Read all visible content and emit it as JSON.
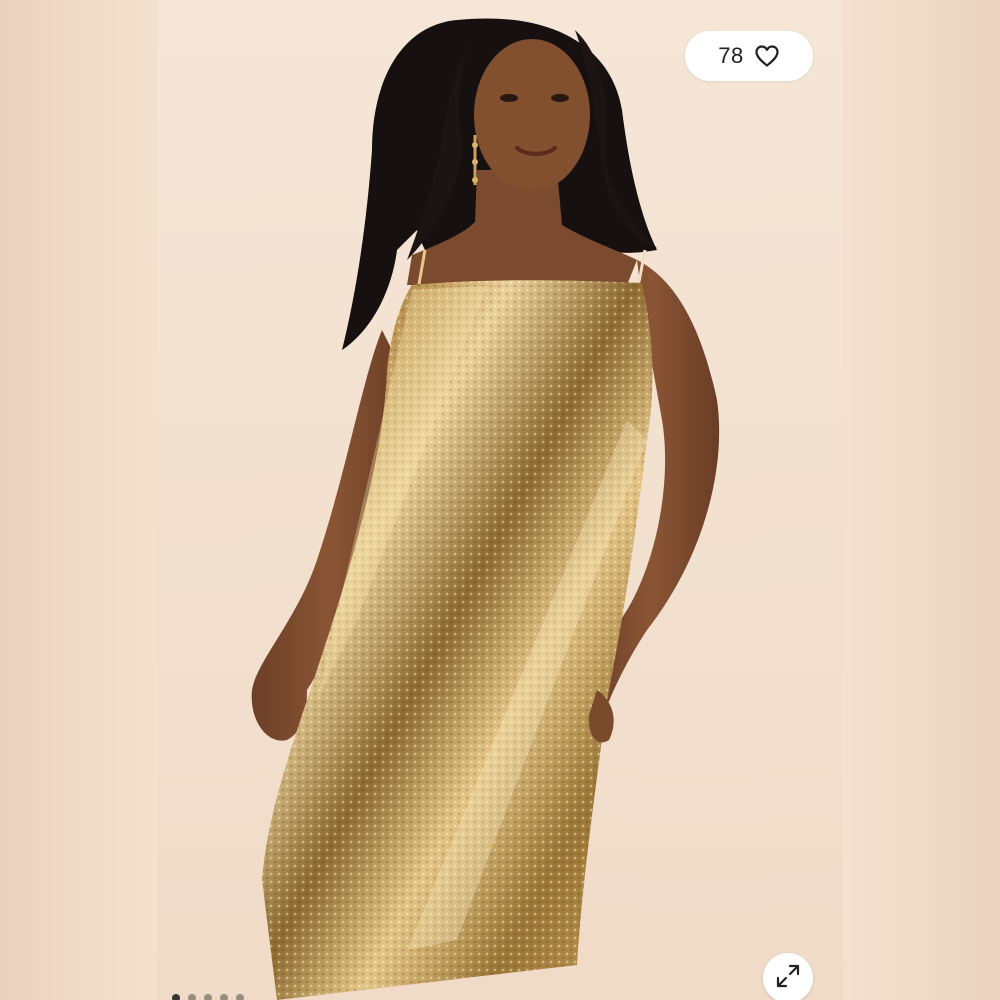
{
  "listing": {
    "likes_count": "78",
    "like_icon": "heart-outline-icon",
    "expand_icon": "expand-arrows-icon",
    "carousel": {
      "total_dots": 5,
      "active_index": 0
    }
  },
  "colors": {
    "background": "#f0dcc8",
    "dress_gold_light": "#e8c98a",
    "dress_gold_dark": "#8a6a32",
    "skin": "#7a4a30",
    "hair": "#161010"
  }
}
